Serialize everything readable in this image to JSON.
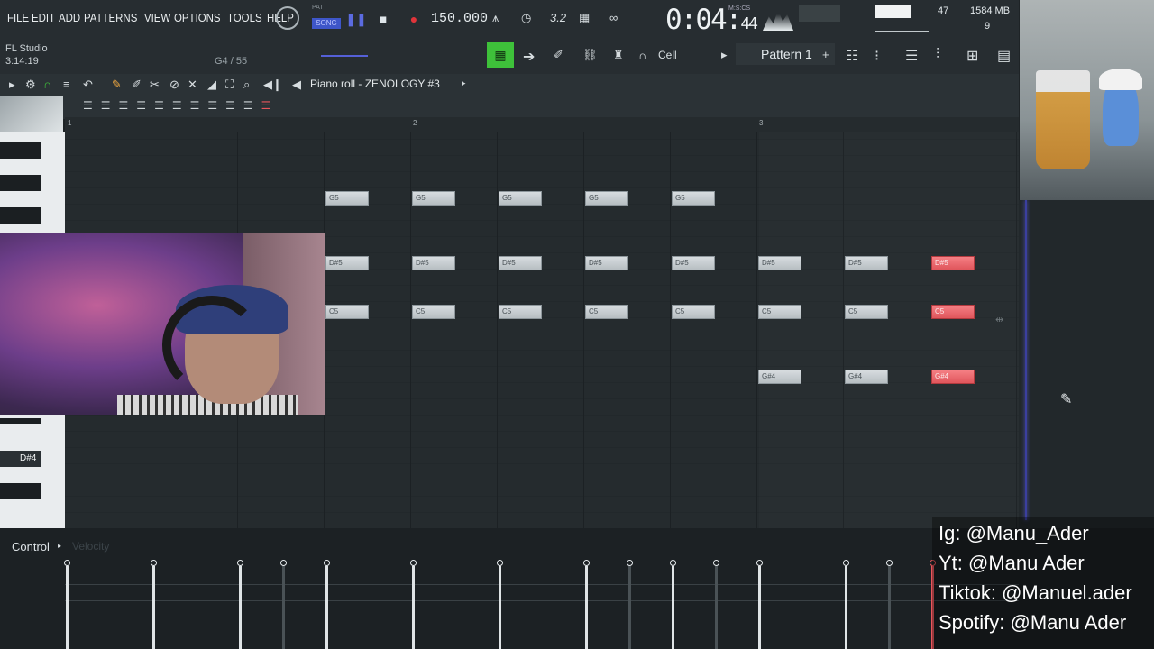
{
  "menu": [
    "FILE",
    "EDIT",
    "ADD",
    "PATTERNS",
    "VIEW",
    "OPTIONS",
    "TOOLS",
    "HELP"
  ],
  "transport": {
    "mode_pat": "PAT",
    "mode_song": "SONG",
    "tempo": "150.000",
    "time_main": "0:04:",
    "time_small": "44",
    "time_unit": "M:S:CS"
  },
  "status": {
    "app_name": "FL Studio",
    "elapsed": "3:14:19",
    "note_pos": "G4 / 55",
    "cpu": "47",
    "memory": "1584 MB",
    "polyphony": "9"
  },
  "pattern": {
    "name": "Pattern 1",
    "snap": "Cell"
  },
  "piano_roll": {
    "title": "Piano roll - ZENOLOGY #3",
    "bars": [
      "1",
      "2",
      "3"
    ],
    "key_label": "D#4"
  },
  "notes": [
    {
      "label": "G5",
      "sel": false
    },
    {
      "label": "G5",
      "sel": false
    },
    {
      "label": "G5",
      "sel": false
    },
    {
      "label": "G5",
      "sel": false
    },
    {
      "label": "G5",
      "sel": false
    },
    {
      "label": "D#5",
      "sel": false
    },
    {
      "label": "D#5",
      "sel": false
    },
    {
      "label": "D#5",
      "sel": false
    },
    {
      "label": "D#5",
      "sel": false
    },
    {
      "label": "D#5",
      "sel": false
    },
    {
      "label": "D#5",
      "sel": false
    },
    {
      "label": "D#5",
      "sel": false
    },
    {
      "label": "D#5",
      "sel": true
    },
    {
      "label": "C5",
      "sel": false
    },
    {
      "label": "C5",
      "sel": false
    },
    {
      "label": "C5",
      "sel": false
    },
    {
      "label": "C5",
      "sel": false
    },
    {
      "label": "C5",
      "sel": false
    },
    {
      "label": "C5",
      "sel": false
    },
    {
      "label": "C5",
      "sel": false
    },
    {
      "label": "C5",
      "sel": true
    },
    {
      "label": "G#4",
      "sel": false
    },
    {
      "label": "G#4",
      "sel": false
    },
    {
      "label": "G#4",
      "sel": true
    }
  ],
  "control": {
    "label": "Control",
    "event": "Velocity"
  },
  "social": [
    "Ig: @Manu_Ader",
    "Yt: @Manu Ader",
    "Tiktok: @Manuel.ader",
    "Spotify: @Manu Ader"
  ],
  "colors": {
    "selected_note": "#e8565c",
    "playhead": "#3b3fa0",
    "record": "#e0343a",
    "active_tool": "#3ec13a"
  },
  "icons": [
    "pause-icon",
    "stop-icon",
    "record-icon",
    "magnet-icon",
    "pencil-icon",
    "brush-icon",
    "mute-icon",
    "zoom-icon",
    "speaker-icon",
    "link-icon",
    "mixer-icon",
    "browser-icon"
  ]
}
